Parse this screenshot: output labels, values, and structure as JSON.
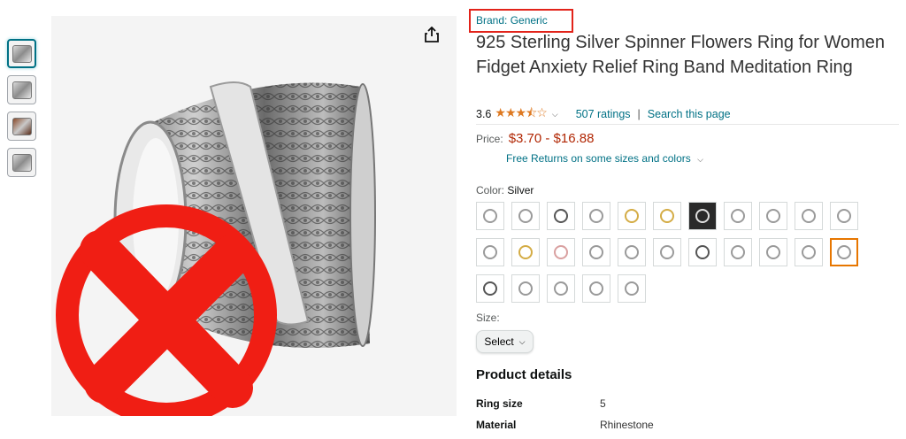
{
  "thumbnails": [
    {
      "name": "thumbnail-1",
      "active": true
    },
    {
      "name": "thumbnail-2",
      "active": false
    },
    {
      "name": "thumbnail-3",
      "active": false
    },
    {
      "name": "thumbnail-4",
      "active": false
    }
  ],
  "brand_link": "Brand: Generic",
  "title": "925 Sterling Silver Spinner Flowers Ring for Women Fidget Anxiety Relief Ring Band Meditation Ring",
  "rating": {
    "value": "3.6",
    "stars": "★★★⯪☆",
    "ratings_count": "507 ratings",
    "separator": "|",
    "search_link": "Search this page"
  },
  "price": {
    "label": "Price:",
    "range": "$3.70 - $16.88",
    "returns": "Free Returns on some sizes and colors"
  },
  "color": {
    "label": "Color:",
    "selected": "Silver",
    "swatch_count": 27,
    "selected_index": 21
  },
  "size": {
    "label": "Size:",
    "select_value": "Select"
  },
  "product_details": {
    "heading": "Product details",
    "rows": [
      {
        "key": "Ring size",
        "value": "5"
      },
      {
        "key": "Material",
        "value": "Rhinestone"
      }
    ]
  },
  "icons": {
    "share": "share-icon",
    "rejection_mark": "red-x-circle-icon"
  },
  "colors": {
    "link": "#007185",
    "price": "#b12704",
    "star": "#de7921",
    "highlight_box": "#e2231a",
    "selected_swatch": "#e77600"
  }
}
